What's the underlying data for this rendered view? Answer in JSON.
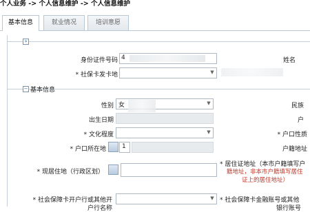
{
  "breadcrumb": {
    "text": "个人业务 -> 个人信息维护 -> 个人信息维护"
  },
  "tabs": [
    {
      "label": "基本信息"
    },
    {
      "label": "就业情况"
    },
    {
      "label": "培训意愿"
    }
  ],
  "top_form": {
    "id_number_label": "身份证件号码",
    "id_number_value": "4",
    "name_label": "姓名",
    "card_issue_label": "* 社保卡发卡地",
    "card_issue_value": "",
    "section_marker": "»"
  },
  "basic_info": {
    "title": "基本信息",
    "gender_label": "性别",
    "gender_value": "女",
    "ethnicity_label": "民族",
    "birth_date_label": "出生日期",
    "household_type_label": "户",
    "education_label": "* 文化程度",
    "hukou_nature_label": "* 户口性质",
    "hukou_location_label": "* 户口所在地",
    "hukou_location_value": "1",
    "hukou_address_label": "户籍地址",
    "residence_label": "* 现居住地（行政区划）",
    "residence_permit_label": "* 居住证地址（本市户籍填写户",
    "residence_note_1": "籍地址，非本市户籍填写居住",
    "residence_note_2": "证上的居住地址）",
    "bank_label": "* 社会保障卡开户行或其他开",
    "bank_label_2": "户行名称",
    "bank_account_label": "* 社会保障卡金融账号或其他",
    "bank_account_label_2": "银行账号"
  }
}
